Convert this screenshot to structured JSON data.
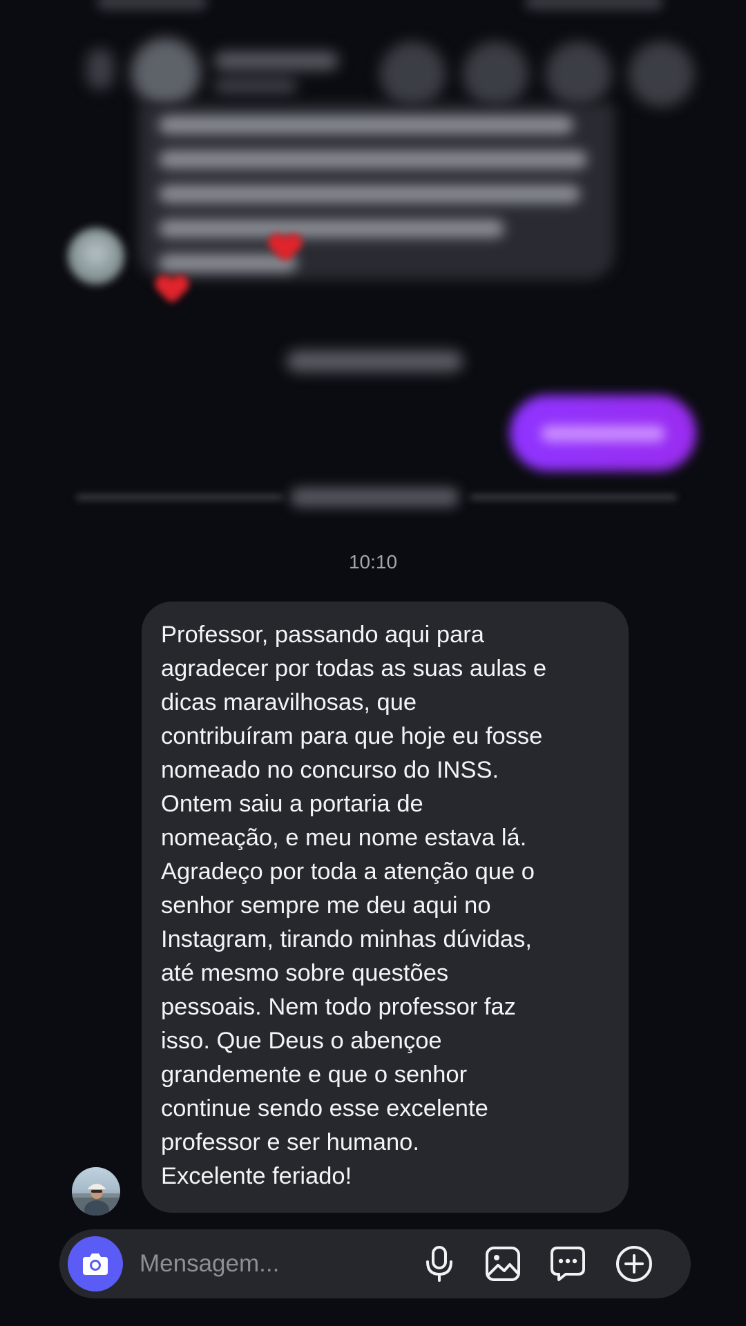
{
  "conversation": {
    "timestamp": "10:10",
    "message": "Professor, passando aqui para\nagradecer por todas as suas aulas e\ndicas maravilhosas, que\ncontribuíram para que hoje eu fosse\nnomeado no concurso do INSS.\nOntem saiu a portaria de\nnomeação, e meu nome estava lá.\nAgradeço por toda a atenção que o\nsenhor sempre me deu aqui no\nInstagram, tirando minhas dúvidas,\naté mesmo sobre questões\npessoais. Nem todo professor faz\nisso. Que Deus o abençoe\ngrandemente e que o senhor\ncontinue sendo esse excelente\nprofessor e ser humano.\nExcelente feriado!"
  },
  "composer": {
    "placeholder": "Mensagem...",
    "camera_icon": "camera-icon",
    "mic_icon": "microphone-icon",
    "gallery_icon": "image-gallery-icon",
    "sticker_icon": "chat-bubble-icon",
    "add_icon": "plus-circle-icon"
  },
  "colors": {
    "background": "#0b0c11",
    "received_bubble": "#27282e",
    "sent_bubble": "#9a2cf0",
    "camera_button": "#5b5cf6"
  }
}
